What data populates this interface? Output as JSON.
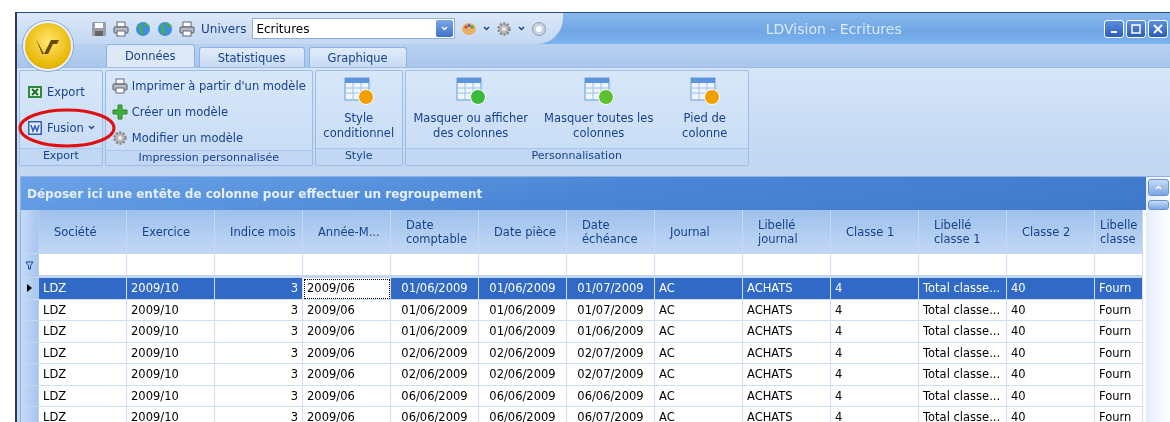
{
  "window": {
    "title": "LDVision - Ecritures"
  },
  "quick_access": {
    "univers_label": "Univers",
    "univers_value": "Ecritures"
  },
  "tabs": [
    {
      "label": "Données",
      "selected": true
    },
    {
      "label": "Statistiques",
      "selected": false
    },
    {
      "label": "Graphique",
      "selected": false
    }
  ],
  "ribbon_groups": [
    {
      "label": "Export",
      "kind": "stack",
      "items": [
        {
          "label": "Export",
          "dropdown": false,
          "highlighted": false
        },
        {
          "label": "Fusion",
          "dropdown": true,
          "highlighted": true
        }
      ]
    },
    {
      "label": "Impression personnalisée",
      "kind": "small",
      "items": [
        {
          "label": "Imprimer à partir d'un modèle"
        },
        {
          "label": "Créer un modèle"
        },
        {
          "label": "Modifier un modèle"
        }
      ]
    },
    {
      "label": "Style",
      "kind": "large",
      "items": [
        {
          "label": "Style conditionnel"
        }
      ]
    },
    {
      "label": "Personnalisation",
      "kind": "large",
      "items": [
        {
          "label": "Masquer ou afficher des colonnes"
        },
        {
          "label": "Masquer toutes les colonnes"
        },
        {
          "label": "Pied de colonne"
        }
      ]
    }
  ],
  "grid": {
    "group_panel": "Déposer ici une entête de colonne pour effectuer un regroupement",
    "columns": [
      {
        "label": "Société",
        "kind": "text",
        "focus": false
      },
      {
        "label": "Exercice",
        "kind": "text",
        "focus": false
      },
      {
        "label": "Indice mois",
        "kind": "number",
        "focus": false
      },
      {
        "label": "Année-M...",
        "kind": "text",
        "focus": true
      },
      {
        "label": "Date comptable",
        "kind": "date",
        "focus": false
      },
      {
        "label": "Date pièce",
        "kind": "date",
        "focus": false
      },
      {
        "label": "Date échéance",
        "kind": "date",
        "focus": false
      },
      {
        "label": "Journal",
        "kind": "text",
        "focus": false
      },
      {
        "label": "Libellé journal",
        "kind": "text",
        "focus": false
      },
      {
        "label": "Classe 1",
        "kind": "text",
        "focus": false
      },
      {
        "label": "Libellé classe 1",
        "kind": "text",
        "focus": false
      },
      {
        "label": "Classe 2",
        "kind": "text",
        "focus": false
      },
      {
        "label": "Libelle classe",
        "kind": "cut",
        "focus": false
      }
    ],
    "rows": [
      {
        "selected": true,
        "cells": [
          "LDZ",
          "2009/10",
          "3",
          "2009/06",
          "01/06/2009",
          "01/06/2009",
          "01/07/2009",
          "AC",
          "ACHATS",
          "4",
          "Total classe...",
          "40",
          "Fourn"
        ]
      },
      {
        "selected": false,
        "cells": [
          "LDZ",
          "2009/10",
          "3",
          "2009/06",
          "01/06/2009",
          "01/06/2009",
          "01/07/2009",
          "AC",
          "ACHATS",
          "4",
          "Total classe...",
          "40",
          "Fourn"
        ]
      },
      {
        "selected": false,
        "cells": [
          "LDZ",
          "2009/10",
          "3",
          "2009/06",
          "01/06/2009",
          "01/06/2009",
          "01/06/2009",
          "AC",
          "ACHATS",
          "4",
          "Total classe...",
          "40",
          "Fourn"
        ]
      },
      {
        "selected": false,
        "cells": [
          "LDZ",
          "2009/10",
          "3",
          "2009/06",
          "02/06/2009",
          "02/06/2009",
          "02/07/2009",
          "AC",
          "ACHATS",
          "4",
          "Total classe...",
          "40",
          "Fourn"
        ]
      },
      {
        "selected": false,
        "cells": [
          "LDZ",
          "2009/10",
          "3",
          "2009/06",
          "02/06/2009",
          "02/06/2009",
          "02/07/2009",
          "AC",
          "ACHATS",
          "4",
          "Total classe...",
          "40",
          "Fourn"
        ]
      },
      {
        "selected": false,
        "cells": [
          "LDZ",
          "2009/10",
          "3",
          "2009/06",
          "06/06/2009",
          "06/06/2009",
          "06/06/2009",
          "AC",
          "ACHATS",
          "4",
          "Total classe...",
          "40",
          "Fourn"
        ]
      },
      {
        "selected": false,
        "cells": [
          "LDZ",
          "2009/10",
          "3",
          "2009/06",
          "06/06/2009",
          "06/06/2009",
          "06/07/2009",
          "AC",
          "ACHATS",
          "4",
          "Total classe...",
          "40",
          "Fourn"
        ]
      }
    ]
  }
}
